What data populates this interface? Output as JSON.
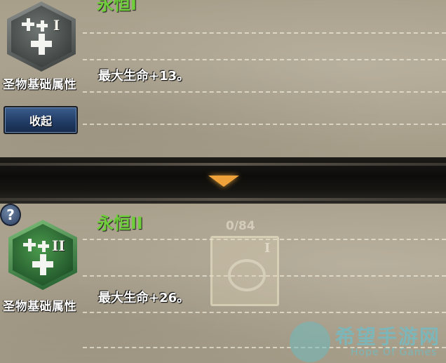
{
  "top_entry": {
    "title": "永恒I",
    "icon_numeral": "I",
    "category_label": "圣物基础属性",
    "effect_text": "最大生命+13。"
  },
  "collapse_button": {
    "label": "收起"
  },
  "bottom_entry": {
    "title": "永恒II",
    "icon_numeral": "II",
    "category_label": "圣物基础属性",
    "effect_text": "最大生命+26。"
  },
  "background_card": {
    "count": "0/84",
    "numeral": "I"
  },
  "help_icon": {
    "glyph": "?"
  },
  "watermark": {
    "title": "希望手游网",
    "subtitle": "Hope Of Games"
  },
  "colors": {
    "tier_title": "#6fcf3a",
    "button": "#203a63",
    "arrow": "#f0a23a",
    "hex_top": "#5e6462",
    "hex_bottom": "#3f8a44"
  },
  "icons": {
    "top_hex": "heal-plus-grey-hex-icon",
    "bottom_hex": "heal-plus-green-hex-icon",
    "expand_arrow": "triangle-down-icon",
    "help": "question-circle-icon"
  }
}
